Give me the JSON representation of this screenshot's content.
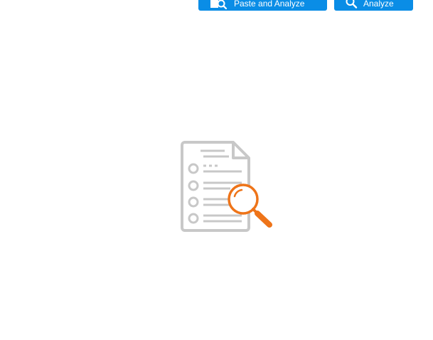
{
  "toolbar": {
    "paste_button": {
      "label": "Paste and Analyze",
      "icon": "paste-search-icon"
    },
    "analyze_button": {
      "label": "Analyze",
      "icon": "search-icon"
    }
  },
  "empty_state": {
    "icon": "document-search-icon"
  },
  "colors": {
    "button_bg": "#0a8de6",
    "button_text": "#ffffff",
    "document_gray": "#c8c8c8",
    "magnifier_orange": "#ee7419"
  }
}
